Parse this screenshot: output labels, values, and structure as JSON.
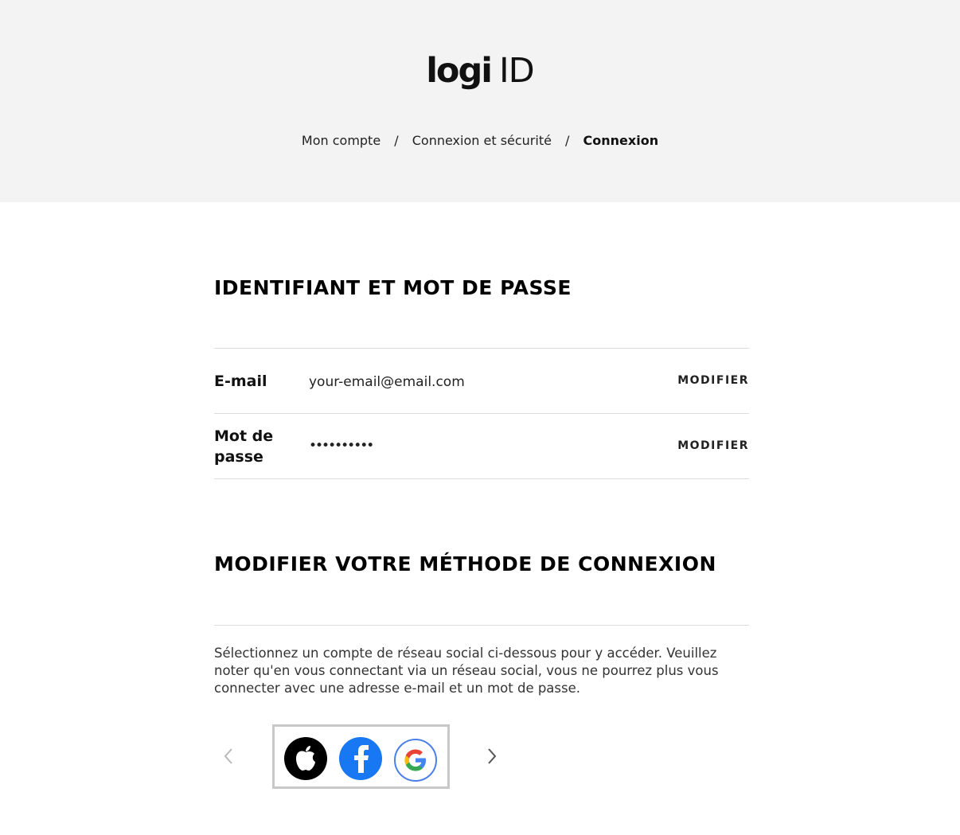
{
  "logo": {
    "bold": "logi",
    "thin": "ID"
  },
  "breadcrumb": [
    {
      "label": "Mon compte"
    },
    {
      "label": "Connexion et sécurité"
    },
    {
      "label": "Connexion"
    }
  ],
  "breadcrumb_separator": "/",
  "credentials": {
    "title": "IDENTIFIANT ET MOT DE PASSE",
    "email": {
      "label": "E-mail",
      "value": "your-email@email.com",
      "action": "MODIFIER"
    },
    "password": {
      "label_line1": "Mot de",
      "label_line2": "passe",
      "value": "••••••••••",
      "action": "MODIFIER"
    }
  },
  "login_method": {
    "title": "MODIFIER VOTRE MÉTHODE DE CONNEXION",
    "description": "Sélectionnez un compte de réseau social ci-dessous pour y accéder. Veuillez noter qu'en vous connectant via un réseau social, vous ne pourrez plus vous connecter avec une adresse e-mail et un mot de passe.",
    "providers": [
      {
        "name": "apple",
        "icon": "apple-icon"
      },
      {
        "name": "facebook",
        "icon": "facebook-icon"
      },
      {
        "name": "google",
        "icon": "google-icon"
      }
    ]
  },
  "colors": {
    "header_bg": "#f3f3f3",
    "facebook": "#1877f2",
    "google_border": "#4a80e8",
    "carousel_frame": "#c8c8c8"
  }
}
